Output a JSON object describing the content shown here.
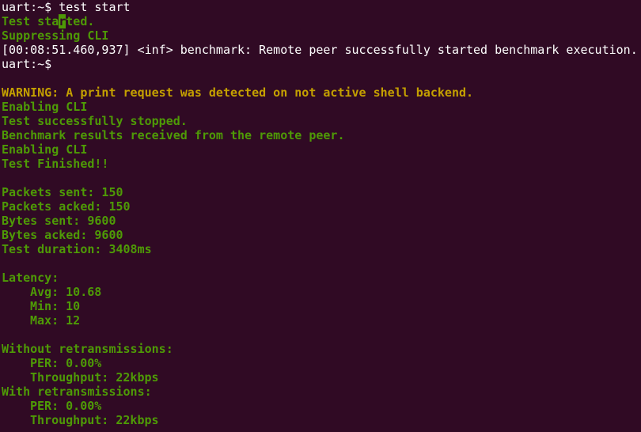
{
  "colors": {
    "background": "#300a24",
    "log_green": "#4e9a06",
    "warning_yellow": "#c4a000",
    "text_white": "#ffffff"
  },
  "terminal": {
    "prompt": "uart:~$",
    "command": "test start",
    "started_before_cursor": "Test sta",
    "started_cursor_char": "r",
    "started_after_cursor": "ted.",
    "suppressing": "Suppressing CLI",
    "log_line": "[00:08:51.460,937] <inf> benchmark: Remote peer successfully started benchmark execution.",
    "prompt2": "uart:~$",
    "warning": "WARNING: A print request was detected on not active shell backend.",
    "enabling1": "Enabling CLI",
    "stopped": "Test successfully stopped.",
    "results": "Benchmark results received from the remote peer.",
    "enabling2": "Enabling CLI",
    "finished": "Test Finished!!",
    "packets_sent": "Packets sent: 150",
    "packets_acked": "Packets acked: 150",
    "bytes_sent": "Bytes sent: 9600",
    "bytes_acked": "Bytes acked: 9600",
    "duration": "Test duration: 3408ms",
    "latency_header": "Latency:",
    "latency_avg": "Avg: 10.68",
    "latency_min": "Min: 10",
    "latency_max": "Max: 12",
    "without_header": "Without retransmissions:",
    "without_per": "PER: 0.00%",
    "without_throughput": "Throughput: 22kbps",
    "with_header": "With retransmissions:",
    "with_per": "PER: 0.00%",
    "with_throughput": "Throughput: 22kbps"
  }
}
